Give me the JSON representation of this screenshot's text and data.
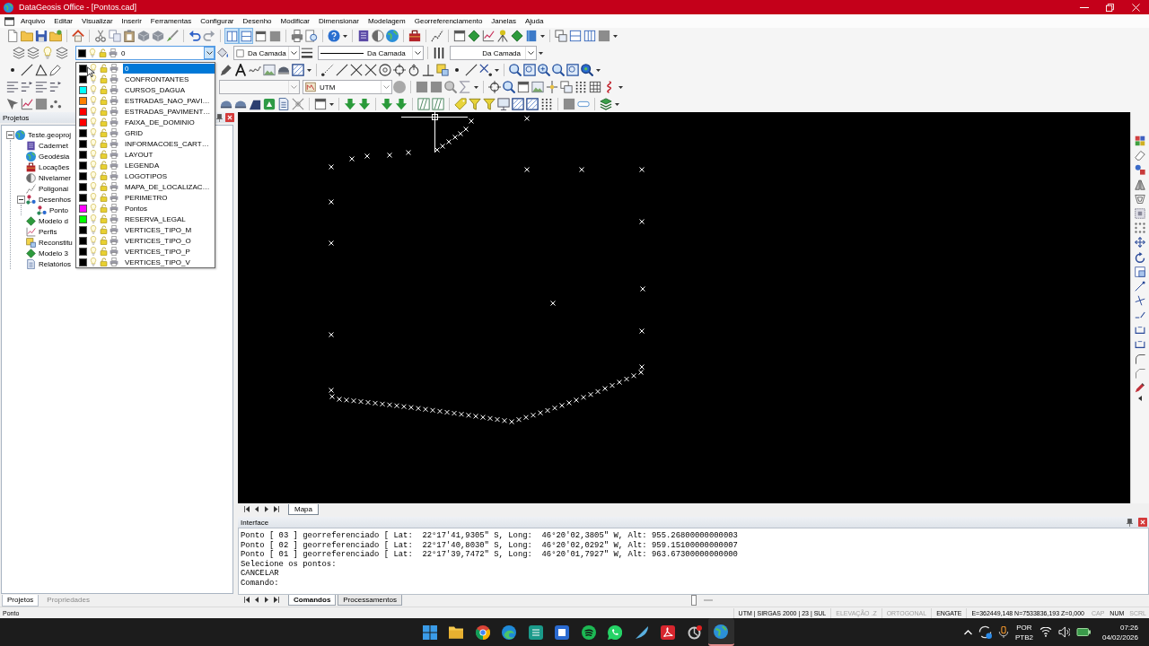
{
  "window": {
    "title": "DataGeosis Office - [Pontos.cad]"
  },
  "menu": [
    "Arquivo",
    "Editar",
    "Visualizar",
    "Inserir",
    "Ferramentas",
    "Configurar",
    "Desenho",
    "Modificar",
    "Dimensionar",
    "Modelagem",
    "Georreferenciamento",
    "Janelas",
    "Ajuda"
  ],
  "toolbar_toggles": [
    {
      "on": true
    },
    {
      "on": true
    },
    {
      "on": false
    },
    {
      "on": false
    }
  ],
  "layer_combo": {
    "value": "0",
    "color": "#000000"
  },
  "color_combo": {
    "value": "Da Camada"
  },
  "linetype_combo": {
    "value": "Da Camada"
  },
  "lineweight_combo": {
    "value": "Da Camada"
  },
  "coordinate_combo": {
    "value": "UTM"
  },
  "layer_dropdown": {
    "items": [
      {
        "name": "0",
        "color": "#000000",
        "selected": true
      },
      {
        "name": "CONFRONTANTES",
        "color": "#000000",
        "selected": false
      },
      {
        "name": "CURSOS_DAGUA",
        "color": "#00ffff",
        "selected": false
      },
      {
        "name": "ESTRADAS_NAO_PAVI…",
        "color": "#ff8000",
        "selected": false
      },
      {
        "name": "ESTRADAS_PAVIMENT…",
        "color": "#ff0000",
        "selected": false
      },
      {
        "name": "FAIXA_DE_DOMINIO",
        "color": "#ff0000",
        "selected": false
      },
      {
        "name": "GRID",
        "color": "#000000",
        "selected": false
      },
      {
        "name": "INFORMACOES_CART…",
        "color": "#000000",
        "selected": false
      },
      {
        "name": "LAYOUT",
        "color": "#000000",
        "selected": false
      },
      {
        "name": "LEGENDA",
        "color": "#000000",
        "selected": false
      },
      {
        "name": "LOGOTIPOS",
        "color": "#000000",
        "selected": false
      },
      {
        "name": "MAPA_DE_LOCALIZAC…",
        "color": "#000000",
        "selected": false
      },
      {
        "name": "PERIMETRO",
        "color": "#000000",
        "selected": false
      },
      {
        "name": "Pontos",
        "color": "#ff00ff",
        "selected": false
      },
      {
        "name": "RESERVA_LEGAL",
        "color": "#00ff00",
        "selected": false
      },
      {
        "name": "VERTICES_TIPO_M",
        "color": "#000000",
        "selected": false
      },
      {
        "name": "VERTICES_TIPO_O",
        "color": "#000000",
        "selected": false
      },
      {
        "name": "VERTICES_TIPO_P",
        "color": "#000000",
        "selected": false
      },
      {
        "name": "VERTICES_TIPO_V",
        "color": "#000000",
        "selected": false
      }
    ]
  },
  "projects_panel": {
    "title": "Projetos",
    "tree": [
      {
        "label": "Teste.geoproj",
        "expanded": true,
        "children": [
          {
            "label": "Cadernet",
            "expanded": false
          },
          {
            "label": "Geodésia",
            "expanded": false
          },
          {
            "label": "Locações",
            "expanded": false
          },
          {
            "label": "Nivelamer",
            "expanded": false
          },
          {
            "label": "Poligonai",
            "expanded": false
          },
          {
            "label": "Desenhos",
            "expanded": true,
            "children": [
              {
                "label": "Ponto",
                "expanded": false
              }
            ]
          },
          {
            "label": "Modelo d",
            "expanded": false
          },
          {
            "label": "Perfis",
            "expanded": false
          },
          {
            "label": "Reconstitu",
            "expanded": false
          },
          {
            "label": "Modelo 3",
            "expanded": false
          },
          {
            "label": "Relatórios",
            "expanded": false
          }
        ]
      }
    ],
    "tabs": [
      {
        "label": "Projetos",
        "selected": true
      },
      {
        "label": "Propriedades",
        "selected": false
      }
    ]
  },
  "document_tabs": [
    {
      "label": "Mapa",
      "selected": true
    }
  ],
  "interface_panel": {
    "title": "Interface",
    "lines": [
      "Ponto [ 03 ] georreferenciado [ Lat:  22°17'41,9305\" S, Long:  46°20'02,3805\" W, Alt: 955.26800000000003",
      "Ponto [ 02 ] georreferenciado [ Lat:  22°17'40,8030\" S, Long:  46°20'02,0292\" W, Alt: 959.15100000000007",
      "Ponto [ 01 ] georreferenciado [ Lat:  22°17'39,7472\" S, Long:  46°20'01,7927\" W, Alt: 963.67300000000000",
      "Selecione os pontos:",
      "CANCELAR",
      "Comando:"
    ],
    "tabs": [
      {
        "label": "Comandos",
        "selected": true
      },
      {
        "label": "Processamentos",
        "selected": false
      }
    ]
  },
  "status_bar": {
    "message": "Ponto",
    "coordinate_system": "UTM | SIRGAS 2000 | 23 | SUL",
    "modes": [
      {
        "label": "ELEVAÇÃO .Z",
        "on": false
      },
      {
        "label": "ORTOGONAL",
        "on": false
      },
      {
        "label": "ENGATE",
        "on": true
      }
    ],
    "coordinates": "E=362449,148 N=7533836,193 Z=0,000",
    "keys": [
      {
        "label": "CAP",
        "on": false
      },
      {
        "label": "NUM",
        "on": true
      },
      {
        "label": "SCRL",
        "on": false
      }
    ]
  },
  "taskbar": {
    "input_language": "POR",
    "keyboard_layout": "PTB2",
    "time": "07:26",
    "date": "04/02/2026"
  }
}
